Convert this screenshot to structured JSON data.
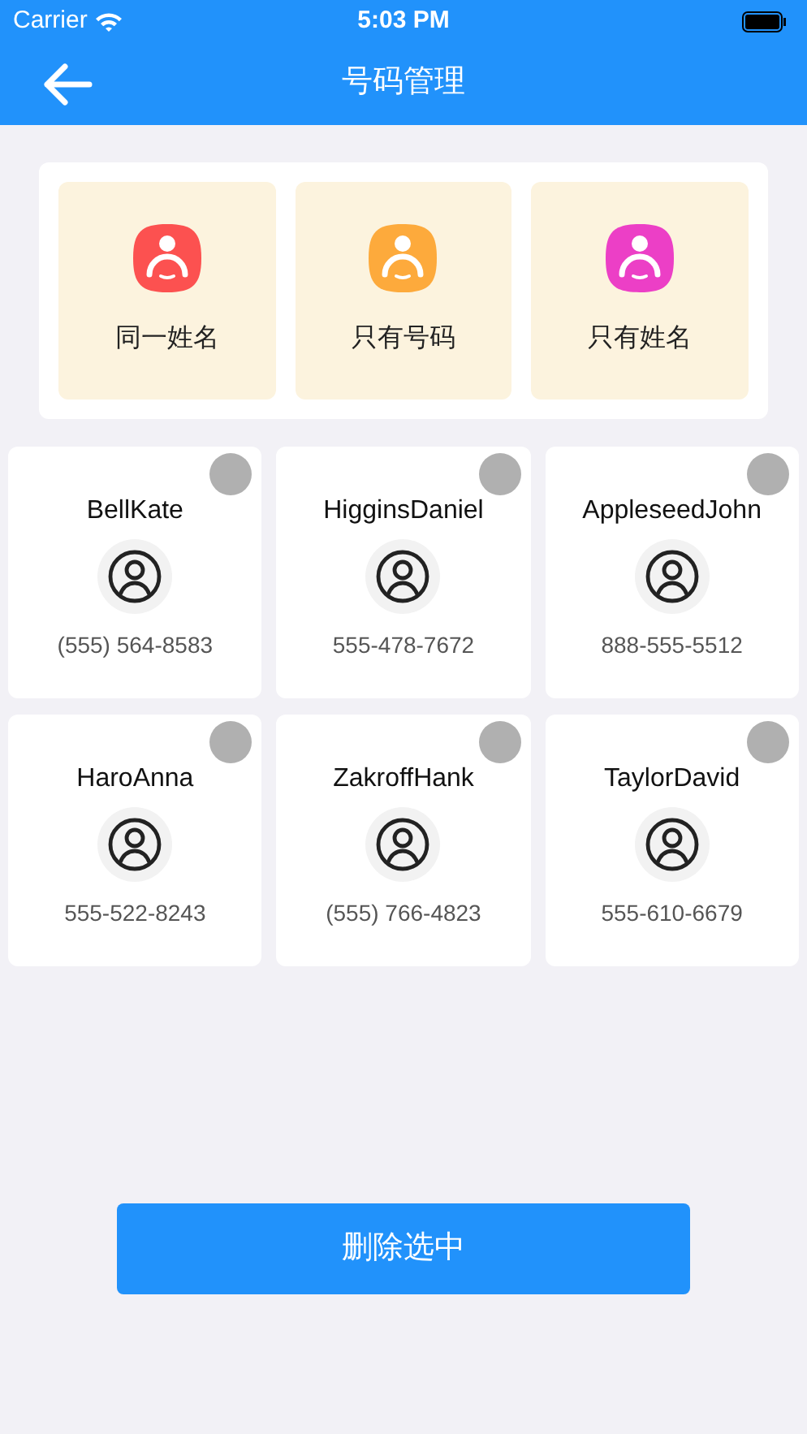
{
  "status_bar": {
    "carrier": "Carrier",
    "time": "5:03 PM"
  },
  "nav": {
    "title": "号码管理"
  },
  "categories": [
    {
      "label": "同一姓名",
      "color": "#fc5150"
    },
    {
      "label": "只有号码",
      "color": "#fdaa3c"
    },
    {
      "label": "只有姓名",
      "color": "#ec3fc6"
    }
  ],
  "contacts": [
    {
      "name": "BellKate",
      "phone": "(555) 564-8583",
      "selected": false
    },
    {
      "name": "HigginsDaniel",
      "phone": "555-478-7672",
      "selected": false
    },
    {
      "name": "AppleseedJohn",
      "phone": "888-555-5512",
      "selected": false
    },
    {
      "name": "HaroAnna",
      "phone": "555-522-8243",
      "selected": false
    },
    {
      "name": "ZakroffHank",
      "phone": "(555) 766-4823",
      "selected": false
    },
    {
      "name": "TaylorDavid",
      "phone": "555-610-6679",
      "selected": false
    }
  ],
  "delete_button": {
    "label": "删除选中"
  }
}
